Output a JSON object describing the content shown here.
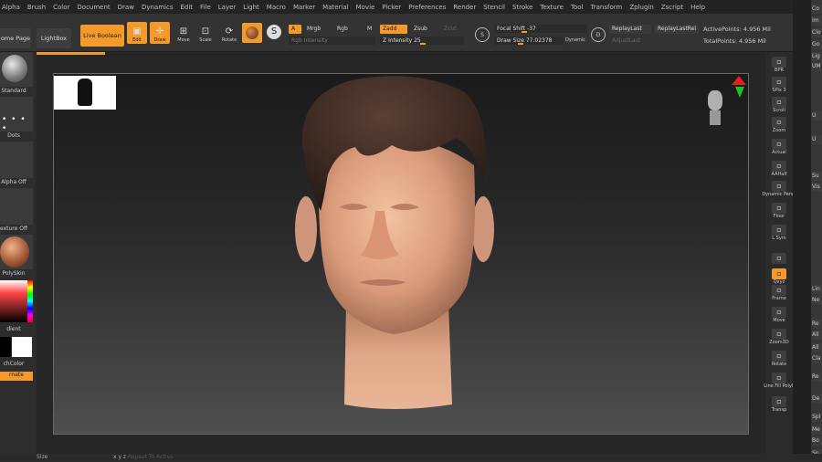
{
  "menu": [
    "Alpha",
    "Brush",
    "Color",
    "Document",
    "Draw",
    "Dynamics",
    "Edit",
    "File",
    "Layer",
    "Light",
    "Macro",
    "Marker",
    "Material",
    "Movie",
    "Picker",
    "Preferences",
    "Render",
    "Stencil",
    "Stroke",
    "Texture",
    "Tool",
    "Transform",
    "Zplugin",
    "Zscript",
    "Help"
  ],
  "toolbar": {
    "home_page": "ome Page",
    "lightbox": "LightBox",
    "live_boolean": "Live Boolean",
    "edit": "Edit",
    "draw": "Draw",
    "move": "Move",
    "scale": "Scale",
    "rotate": "Rotate",
    "a_label": "A",
    "mrgb": "Mrgb",
    "rgb": "Rgb",
    "m": "M",
    "rgb_intensity": "Rgb Intensity",
    "zadd": "Zadd",
    "zsub": "Zsub",
    "zcut": "Zcut",
    "z_intensity_label": "Z Intensity",
    "z_intensity_value": "25",
    "focal_shift_label": "Focal Shift",
    "focal_shift_value": "-37",
    "draw_size_label": "Draw Size",
    "draw_size_value": "77.02378",
    "dynamic": "Dynamic",
    "replay_last": "ReplayLast",
    "replay_last_rel": "ReplayLastRel",
    "adjust_last": "AdjustLast",
    "active_points": "ActivePoints: 4.956 Mil",
    "total_points": "TotalPoints: 4.956 Mil",
    "s_label": "S",
    "d_label": "D"
  },
  "left_shelf": {
    "brush": "Standard",
    "stroke": "Dots",
    "alpha": "Alpha Off",
    "texture": "exture Off",
    "material": "PolySkin",
    "gradient": "dient",
    "switch_color": "chColor",
    "alternate": "rnate"
  },
  "right_shelf": [
    {
      "name": "bpr",
      "label": "BPR"
    },
    {
      "name": "spix",
      "label": "SPix 3"
    },
    {
      "name": "scroll",
      "label": "Scroll"
    },
    {
      "name": "zoom",
      "label": "Zoom"
    },
    {
      "name": "actual",
      "label": "Actual"
    },
    {
      "name": "aahalf",
      "label": "AAHalf"
    },
    {
      "name": "dynamic-persp",
      "label": "Dynamic Persp"
    },
    {
      "name": "floor",
      "label": "Floor"
    },
    {
      "name": "lsym",
      "label": "L.Sym"
    },
    {
      "name": "lock",
      "label": ""
    },
    {
      "name": "qxyz",
      "label": "Qxyz"
    },
    {
      "name": "frame",
      "label": "Frame"
    },
    {
      "name": "move",
      "label": "Move"
    },
    {
      "name": "zoom3d",
      "label": "Zoom3D"
    },
    {
      "name": "rotate",
      "label": "Rotate"
    },
    {
      "name": "line-fill",
      "label": "Line Fill PolyF"
    },
    {
      "name": "transp",
      "label": "Transp"
    }
  ],
  "right_panel": [
    "Co",
    "Im",
    "Clo",
    "Go",
    "Lig",
    "UM",
    "U",
    "U",
    "Su",
    "Vis",
    "Lin",
    "Ne",
    "Re",
    "All",
    "All",
    "Cla",
    "Re",
    "De",
    "Spl",
    "Me",
    "Bo",
    "Sp"
  ],
  "status": {
    "size": "Size",
    "xyz": "x y z",
    "repeat": "Repeat To Active"
  },
  "colors": {
    "accent": "#f39a2a",
    "bg": "#2b2b2b"
  }
}
